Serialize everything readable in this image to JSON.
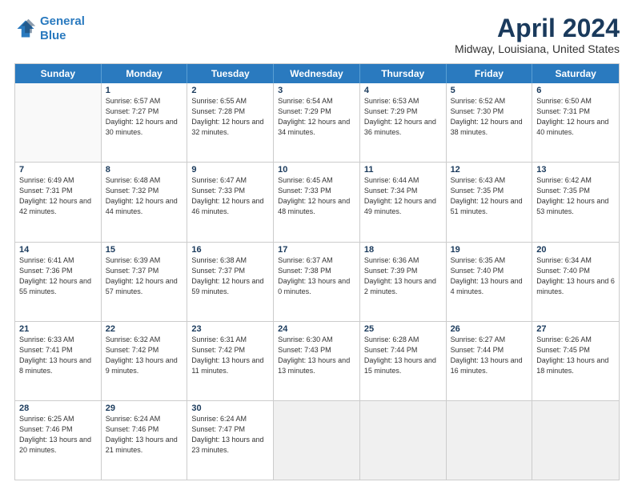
{
  "logo": {
    "line1": "General",
    "line2": "Blue"
  },
  "title": "April 2024",
  "subtitle": "Midway, Louisiana, United States",
  "days_of_week": [
    "Sunday",
    "Monday",
    "Tuesday",
    "Wednesday",
    "Thursday",
    "Friday",
    "Saturday"
  ],
  "weeks": [
    [
      {
        "day": "",
        "sunrise": "",
        "sunset": "",
        "daylight": "",
        "empty": true
      },
      {
        "day": "1",
        "sunrise": "6:57 AM",
        "sunset": "7:27 PM",
        "daylight": "12 hours and 30 minutes."
      },
      {
        "day": "2",
        "sunrise": "6:55 AM",
        "sunset": "7:28 PM",
        "daylight": "12 hours and 32 minutes."
      },
      {
        "day": "3",
        "sunrise": "6:54 AM",
        "sunset": "7:29 PM",
        "daylight": "12 hours and 34 minutes."
      },
      {
        "day": "4",
        "sunrise": "6:53 AM",
        "sunset": "7:29 PM",
        "daylight": "12 hours and 36 minutes."
      },
      {
        "day": "5",
        "sunrise": "6:52 AM",
        "sunset": "7:30 PM",
        "daylight": "12 hours and 38 minutes."
      },
      {
        "day": "6",
        "sunrise": "6:50 AM",
        "sunset": "7:31 PM",
        "daylight": "12 hours and 40 minutes."
      }
    ],
    [
      {
        "day": "7",
        "sunrise": "6:49 AM",
        "sunset": "7:31 PM",
        "daylight": "12 hours and 42 minutes."
      },
      {
        "day": "8",
        "sunrise": "6:48 AM",
        "sunset": "7:32 PM",
        "daylight": "12 hours and 44 minutes."
      },
      {
        "day": "9",
        "sunrise": "6:47 AM",
        "sunset": "7:33 PM",
        "daylight": "12 hours and 46 minutes."
      },
      {
        "day": "10",
        "sunrise": "6:45 AM",
        "sunset": "7:33 PM",
        "daylight": "12 hours and 48 minutes."
      },
      {
        "day": "11",
        "sunrise": "6:44 AM",
        "sunset": "7:34 PM",
        "daylight": "12 hours and 49 minutes."
      },
      {
        "day": "12",
        "sunrise": "6:43 AM",
        "sunset": "7:35 PM",
        "daylight": "12 hours and 51 minutes."
      },
      {
        "day": "13",
        "sunrise": "6:42 AM",
        "sunset": "7:35 PM",
        "daylight": "12 hours and 53 minutes."
      }
    ],
    [
      {
        "day": "14",
        "sunrise": "6:41 AM",
        "sunset": "7:36 PM",
        "daylight": "12 hours and 55 minutes."
      },
      {
        "day": "15",
        "sunrise": "6:39 AM",
        "sunset": "7:37 PM",
        "daylight": "12 hours and 57 minutes."
      },
      {
        "day": "16",
        "sunrise": "6:38 AM",
        "sunset": "7:37 PM",
        "daylight": "12 hours and 59 minutes."
      },
      {
        "day": "17",
        "sunrise": "6:37 AM",
        "sunset": "7:38 PM",
        "daylight": "13 hours and 0 minutes."
      },
      {
        "day": "18",
        "sunrise": "6:36 AM",
        "sunset": "7:39 PM",
        "daylight": "13 hours and 2 minutes."
      },
      {
        "day": "19",
        "sunrise": "6:35 AM",
        "sunset": "7:40 PM",
        "daylight": "13 hours and 4 minutes."
      },
      {
        "day": "20",
        "sunrise": "6:34 AM",
        "sunset": "7:40 PM",
        "daylight": "13 hours and 6 minutes."
      }
    ],
    [
      {
        "day": "21",
        "sunrise": "6:33 AM",
        "sunset": "7:41 PM",
        "daylight": "13 hours and 8 minutes."
      },
      {
        "day": "22",
        "sunrise": "6:32 AM",
        "sunset": "7:42 PM",
        "daylight": "13 hours and 9 minutes."
      },
      {
        "day": "23",
        "sunrise": "6:31 AM",
        "sunset": "7:42 PM",
        "daylight": "13 hours and 11 minutes."
      },
      {
        "day": "24",
        "sunrise": "6:30 AM",
        "sunset": "7:43 PM",
        "daylight": "13 hours and 13 minutes."
      },
      {
        "day": "25",
        "sunrise": "6:28 AM",
        "sunset": "7:44 PM",
        "daylight": "13 hours and 15 minutes."
      },
      {
        "day": "26",
        "sunrise": "6:27 AM",
        "sunset": "7:44 PM",
        "daylight": "13 hours and 16 minutes."
      },
      {
        "day": "27",
        "sunrise": "6:26 AM",
        "sunset": "7:45 PM",
        "daylight": "13 hours and 18 minutes."
      }
    ],
    [
      {
        "day": "28",
        "sunrise": "6:25 AM",
        "sunset": "7:46 PM",
        "daylight": "13 hours and 20 minutes."
      },
      {
        "day": "29",
        "sunrise": "6:24 AM",
        "sunset": "7:46 PM",
        "daylight": "13 hours and 21 minutes."
      },
      {
        "day": "30",
        "sunrise": "6:24 AM",
        "sunset": "7:47 PM",
        "daylight": "13 hours and 23 minutes."
      },
      {
        "day": "",
        "sunrise": "",
        "sunset": "",
        "daylight": "",
        "empty": true
      },
      {
        "day": "",
        "sunrise": "",
        "sunset": "",
        "daylight": "",
        "empty": true
      },
      {
        "day": "",
        "sunrise": "",
        "sunset": "",
        "daylight": "",
        "empty": true
      },
      {
        "day": "",
        "sunrise": "",
        "sunset": "",
        "daylight": "",
        "empty": true
      }
    ]
  ],
  "labels": {
    "sunrise": "Sunrise:",
    "sunset": "Sunset:",
    "daylight": "Daylight:"
  }
}
